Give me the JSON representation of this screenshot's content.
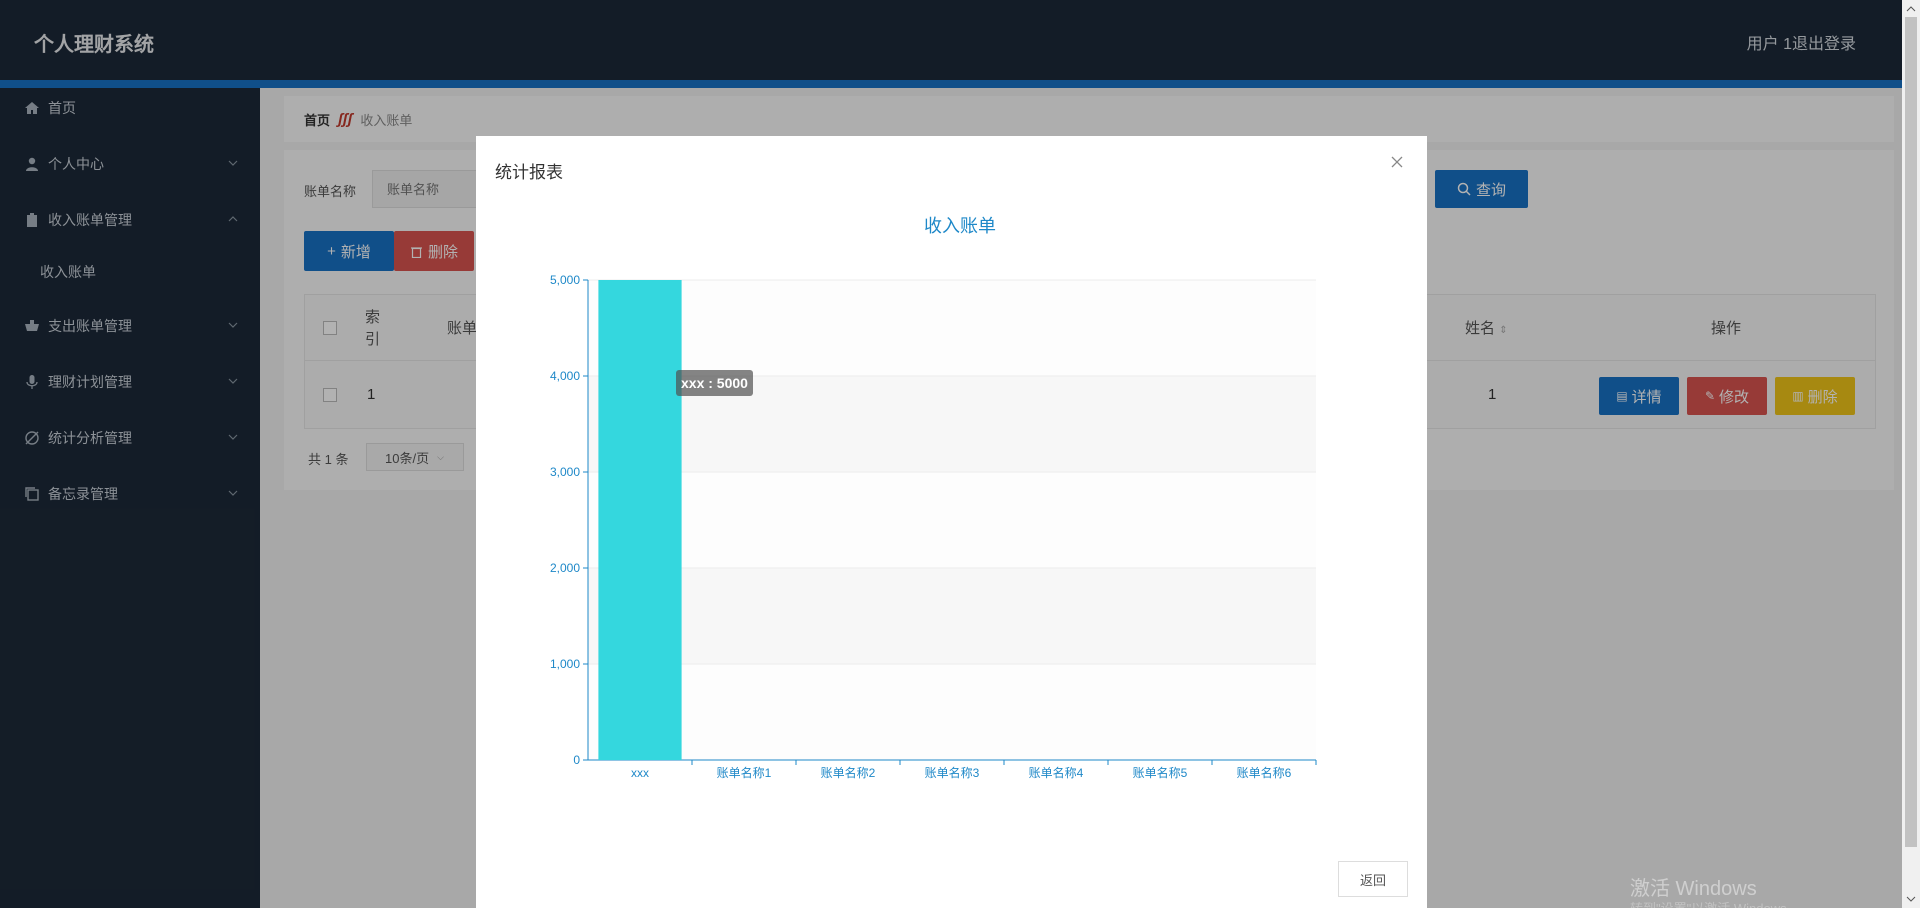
{
  "header": {
    "app_title": "个人理财系统",
    "user": "用户 1",
    "logout": "退出登录"
  },
  "sidebar": {
    "items": [
      {
        "label": "首页",
        "icon": "home-icon"
      },
      {
        "label": "个人中心",
        "icon": "user-icon"
      },
      {
        "label": "收入账单管理",
        "icon": "clipboard-icon"
      },
      {
        "label": "收入账单",
        "icon": ""
      },
      {
        "label": "支出账单管理",
        "icon": "cart-icon"
      },
      {
        "label": "理财计划管理",
        "icon": "microphone-icon"
      },
      {
        "label": "统计分析管理",
        "icon": "chart-icon"
      },
      {
        "label": "备忘录管理",
        "icon": "copy-icon"
      }
    ]
  },
  "breadcrumb": {
    "home": "首页",
    "current": "收入账单"
  },
  "search": {
    "label": "账单名称",
    "placeholder": "账单名称",
    "query": "查询"
  },
  "toolbar": {
    "add": "新增",
    "delete": "删除"
  },
  "table": {
    "headers": {
      "index": "索引",
      "name": "账单",
      "person": "姓名",
      "actions": "操作"
    },
    "rows": [
      {
        "index": "1",
        "person": "1"
      }
    ],
    "row_buttons": {
      "detail": "详情",
      "edit": "修改",
      "delete": "删除"
    }
  },
  "pager": {
    "total": "共 1 条",
    "size": "10条/页"
  },
  "modal": {
    "title": "统计报表",
    "return": "返回"
  },
  "tooltip": "xxx : 5000",
  "chart_data": {
    "type": "bar",
    "title": "收入账单",
    "categories": [
      "xxx",
      "账单名称1",
      "账单名称2",
      "账单名称3",
      "账单名称4",
      "账单名称5",
      "账单名称6"
    ],
    "values": [
      5000,
      0,
      0,
      0,
      0,
      0,
      0
    ],
    "ylim": [
      0,
      5000
    ],
    "yticks": [
      0,
      1000,
      2000,
      3000,
      4000,
      5000
    ],
    "ytick_labels": [
      "0",
      "1,000",
      "2,000",
      "3,000",
      "4,000",
      "5,000"
    ],
    "bar_color": "#34d7de",
    "axis_color": "#1e88c8"
  },
  "watermark": {
    "line1": "激活 Windows",
    "line2": "转到\"设置\"以激活 Windows。"
  }
}
